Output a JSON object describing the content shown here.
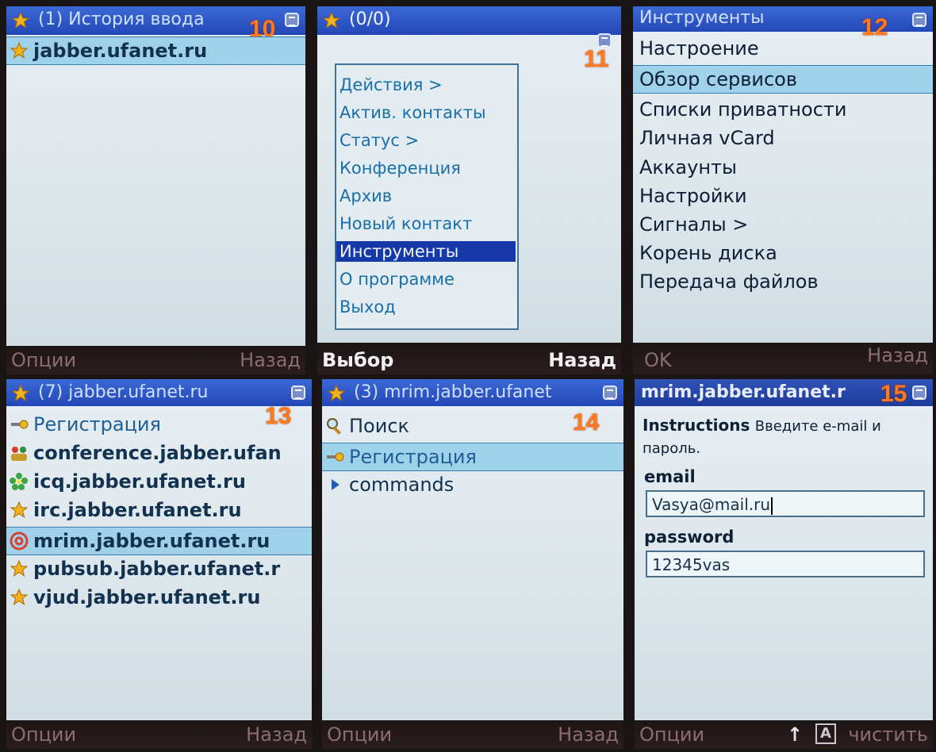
{
  "colors": {
    "title_bar": "#2447b8",
    "selection": "#9fd1ea",
    "menu_selection": "#1638a8",
    "step_number": "#ff7a1a",
    "menu_text": "#1a6fa8"
  },
  "panels": [
    {
      "step": "10",
      "title": "(1) История ввода",
      "items": [
        {
          "label": "jabber.ufanet.ru",
          "icon": "star-icon",
          "selected": true
        }
      ],
      "soft_left": "Опции",
      "soft_right": "Назад"
    },
    {
      "step": "11",
      "title": "(0/0)",
      "menu": [
        "Действия >",
        "Актив. контакты",
        "Статус >",
        "Конференция",
        "Архив",
        "Новый контакт",
        "Инструменты",
        "О программе",
        "Выход"
      ],
      "menu_selected_index": 6,
      "soft_left": "Выбор",
      "soft_right": "Назад"
    },
    {
      "step": "12",
      "title": "Инструменты",
      "items": [
        "Настроение",
        "Обзор сервисов",
        "Списки приватности",
        "Личная vCard",
        "Аккаунты",
        "Настройки",
        "Сигналы >",
        "Корень диска",
        "Передача файлов"
      ],
      "selected_index": 1,
      "soft_left": "OK",
      "soft_right": "Назад"
    },
    {
      "step": "13",
      "title": "(7) jabber.ufanet.ru",
      "items": [
        {
          "label": "Регистрация",
          "icon": "key-icon"
        },
        {
          "label": "conference.jabber.ufan",
          "icon": "group-icon"
        },
        {
          "label": "icq.jabber.ufanet.ru",
          "icon": "icq-flower-icon"
        },
        {
          "label": "irc.jabber.ufanet.ru",
          "icon": "star-icon"
        },
        {
          "label": "mrim.jabber.ufanet.ru",
          "icon": "at-icon",
          "selected": true
        },
        {
          "label": "pubsub.jabber.ufanet.r",
          "icon": "star-icon"
        },
        {
          "label": "vjud.jabber.ufanet.ru",
          "icon": "star-icon"
        }
      ],
      "soft_left": "Опции",
      "soft_right": "Назад"
    },
    {
      "step": "14",
      "title": "(3) mrim.jabber.ufanet",
      "items": [
        {
          "label": "Поиск",
          "icon": "search-tools-icon"
        },
        {
          "label": "Регистрация",
          "icon": "key-icon",
          "selected": true
        },
        {
          "label": "commands",
          "icon": "triangle-right-icon"
        }
      ],
      "soft_left": "Опции",
      "soft_right": "Назад"
    },
    {
      "step": "15",
      "title": "mrim.jabber.ufanet.r",
      "instructions_label": "Instructions",
      "instructions_text": "Введите e-mail и",
      "instructions_text2": "пароль.",
      "email_label": "email",
      "email_value": "Vasya@mail.ru",
      "password_label": "password",
      "password_value": "12345vas",
      "soft_left": "Опции",
      "soft_mid_arrow": "↑",
      "soft_mid_mode": "A",
      "soft_right": "чистить"
    }
  ]
}
